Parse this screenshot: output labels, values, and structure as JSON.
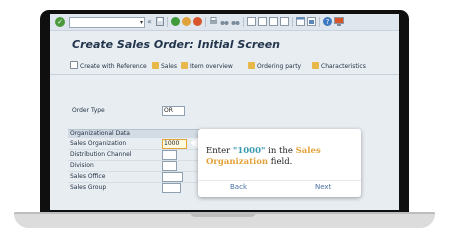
{
  "toolbar": {
    "ok_glyph": "✓",
    "command_field": "",
    "dropdown_glyph": "▾",
    "back_glyph": "«"
  },
  "screen": {
    "title": "Create Sales Order: Initial Screen"
  },
  "app_toolbar": {
    "create_with_reference": "Create with Reference",
    "sales": "Sales",
    "item_overview": "Item overview",
    "ordering_party": "Ordering party",
    "characteristics": "Characteristics"
  },
  "form": {
    "order_type_label": "Order Type",
    "order_type_value": "OR",
    "org_data_header": "Organizational Data",
    "sales_org_label": "Sales Organization",
    "sales_org_value": "1000",
    "dist_channel_label": "Distribution Channel",
    "division_label": "Division",
    "sales_office_label": "Sales Office",
    "sales_group_label": "Sales Group"
  },
  "callout": {
    "text_enter": "Enter",
    "text_value": "\"1000\"",
    "text_in_the": "in the",
    "text_field_name_1": "Sales",
    "text_field_name_2": "Organization",
    "text_field": "field.",
    "back_label": "Back",
    "next_label": "Next"
  },
  "colors": {
    "accent_orange": "#e3a23a",
    "accent_teal": "#3a9ab0",
    "title_blue": "#22354c"
  }
}
